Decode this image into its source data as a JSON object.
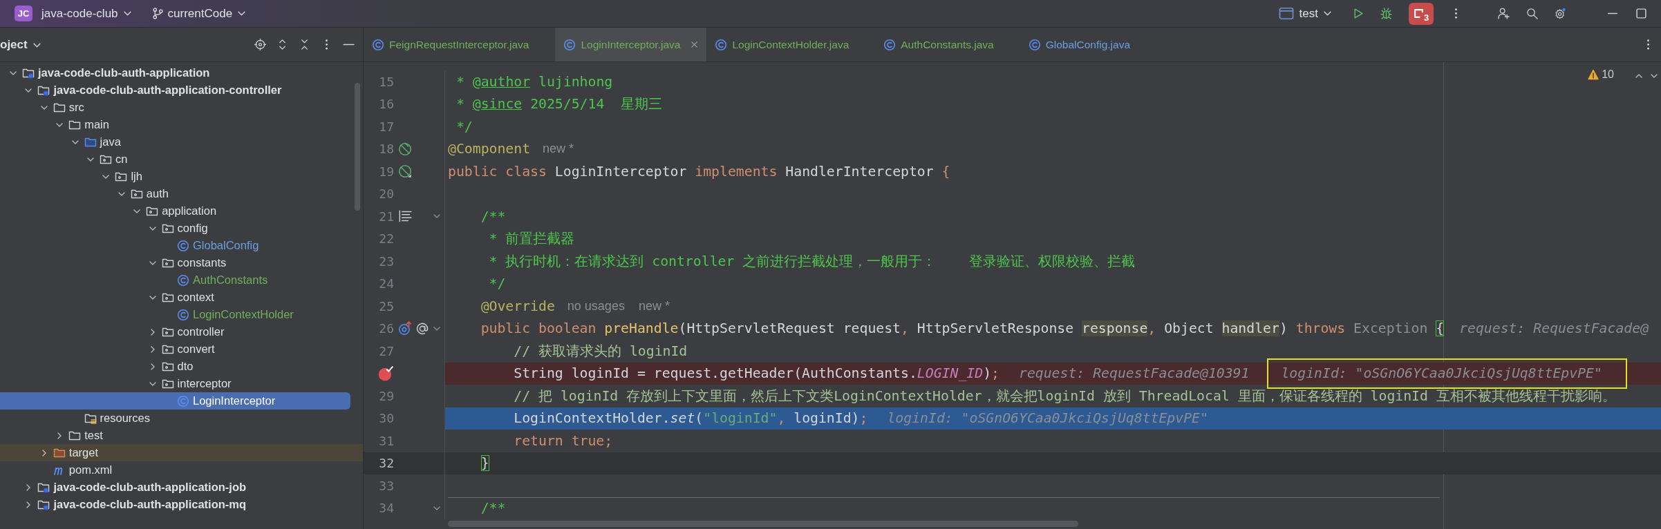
{
  "title_bar": {
    "logo": "JC",
    "project": "java-code-club",
    "branch": "currentCode",
    "run_config": "test",
    "sessions_count": "3"
  },
  "project_panel": {
    "title": "oject",
    "tree": [
      {
        "label": "java-code-club-auth-application",
        "kind": "module",
        "expanded": true,
        "selected": false,
        "children": [
          {
            "label": "java-code-club-auth-application-controller",
            "kind": "module",
            "expanded": true,
            "selected": false,
            "children": [
              {
                "label": "src",
                "kind": "folder",
                "expanded": true,
                "selected": false,
                "children": [
                  {
                    "label": "main",
                    "kind": "folder",
                    "expanded": true,
                    "selected": false,
                    "children": [
                      {
                        "label": "java",
                        "kind": "source",
                        "expanded": true,
                        "selected": false,
                        "children": [
                          {
                            "label": "cn",
                            "kind": "package",
                            "expanded": true,
                            "selected": false,
                            "children": [
                              {
                                "label": "ljh",
                                "kind": "package",
                                "expanded": true,
                                "selected": false,
                                "children": [
                                  {
                                    "label": "auth",
                                    "kind": "package",
                                    "expanded": true,
                                    "selected": false,
                                    "children": [
                                      {
                                        "label": "application",
                                        "kind": "package",
                                        "expanded": true,
                                        "selected": false,
                                        "children": [
                                          {
                                            "label": "config",
                                            "kind": "package",
                                            "expanded": true,
                                            "selected": false,
                                            "children": [
                                              {
                                                "label": "GlobalConfig",
                                                "kind": "class",
                                                "color": "#6a9fe0",
                                                "selected": false
                                              }
                                            ]
                                          },
                                          {
                                            "label": "constants",
                                            "kind": "package",
                                            "expanded": true,
                                            "selected": false,
                                            "children": [
                                              {
                                                "label": "AuthConstants",
                                                "kind": "class",
                                                "color": "#6fb05a",
                                                "selected": false
                                              }
                                            ]
                                          },
                                          {
                                            "label": "context",
                                            "kind": "package",
                                            "expanded": true,
                                            "selected": false,
                                            "children": [
                                              {
                                                "label": "LoginContextHolder",
                                                "kind": "class",
                                                "color": "#6fb05a",
                                                "selected": false
                                              }
                                            ]
                                          },
                                          {
                                            "label": "controller",
                                            "kind": "package",
                                            "expanded": false,
                                            "selected": false
                                          },
                                          {
                                            "label": "convert",
                                            "kind": "package",
                                            "expanded": false,
                                            "selected": false
                                          },
                                          {
                                            "label": "dto",
                                            "kind": "package",
                                            "expanded": false,
                                            "selected": false
                                          },
                                          {
                                            "label": "interceptor",
                                            "kind": "package",
                                            "expanded": true,
                                            "selected": false,
                                            "children": [
                                              {
                                                "label": "LoginInterceptor",
                                                "kind": "class",
                                                "selected": true
                                              }
                                            ]
                                          }
                                        ]
                                      }
                                    ]
                                  }
                                ]
                              }
                            ]
                          }
                        ]
                      },
                      {
                        "label": "resources",
                        "kind": "resources",
                        "selected": false
                      }
                    ]
                  },
                  {
                    "label": "test",
                    "kind": "folder",
                    "expanded": false,
                    "selected": false
                  }
                ]
              },
              {
                "label": "target",
                "kind": "excluded",
                "expanded": false,
                "selected": false
              },
              {
                "label": "pom.xml",
                "kind": "maven",
                "selected": false
              }
            ]
          },
          {
            "label": "java-code-club-auth-application-job",
            "kind": "module",
            "expanded": false,
            "selected": false
          },
          {
            "label": "java-code-club-auth-application-mq",
            "kind": "module",
            "expanded": false,
            "selected": false
          }
        ]
      }
    ]
  },
  "editor_tabs": [
    {
      "label": "FeignRequestInterceptor.java",
      "color": "#6fb05a",
      "selected": false
    },
    {
      "label": "LoginInterceptor.java",
      "color": "#6fb05a",
      "selected": true
    },
    {
      "label": "LoginContextHolder.java",
      "color": "#6fb05a",
      "selected": false
    },
    {
      "label": "AuthConstants.java",
      "color": "#6fb05a",
      "selected": false
    },
    {
      "label": "GlobalConfig.java",
      "color": "#6a9fe0",
      "selected": false
    }
  ],
  "editor": {
    "warnings": "10",
    "lines": [
      {
        "number": "15",
        "tokens": [
          {
            "text": " * ",
            "kind": "doc"
          },
          {
            "text": "@author",
            "kind": "doc-tag"
          },
          {
            "text": " lujinhong",
            "kind": "doc"
          }
        ]
      },
      {
        "number": "16",
        "tokens": [
          {
            "text": " * ",
            "kind": "doc"
          },
          {
            "text": "@since",
            "kind": "doc-tag"
          },
          {
            "text": " 2025/5/14  星期三",
            "kind": "doc"
          }
        ]
      },
      {
        "number": "17",
        "tokens": [
          {
            "text": " */",
            "kind": "doc"
          }
        ]
      },
      {
        "number": "18",
        "gutter": [
          {
            "kind": "bean"
          }
        ],
        "tokens": [
          {
            "text": "@Component",
            "kind": "annotation"
          },
          {
            "text": "new *",
            "kind": "hint"
          }
        ]
      },
      {
        "number": "19",
        "gutter": [
          {
            "kind": "bean-ref"
          }
        ],
        "tokens": [
          {
            "text": "public class ",
            "kind": "keyword"
          },
          {
            "text": "LoginInterceptor ",
            "kind": "plain"
          },
          {
            "text": "implements ",
            "kind": "keyword"
          },
          {
            "text": "HandlerInterceptor ",
            "kind": "plain"
          },
          {
            "text": "{",
            "kind": "keyword"
          }
        ]
      },
      {
        "number": "20"
      },
      {
        "number": "21",
        "gutter": [
          {
            "kind": "doc"
          }
        ],
        "foldable": true,
        "tokens": [
          {
            "text": "    /**",
            "kind": "doc"
          }
        ]
      },
      {
        "number": "22",
        "tokens": [
          {
            "text": "     * 前置拦截器",
            "kind": "doc"
          }
        ]
      },
      {
        "number": "23",
        "tokens": [
          {
            "text": "     * 执行时机：在请求达到 controller 之前进行拦截处理，一般用于：    登录验证、权限校验、拦截",
            "kind": "doc"
          }
        ]
      },
      {
        "number": "24",
        "tokens": [
          {
            "text": "     */",
            "kind": "doc"
          }
        ]
      },
      {
        "number": "25",
        "tokens": [
          {
            "text": "    @Override",
            "kind": "annotation"
          },
          {
            "text": "no usages",
            "kind": "hint"
          },
          {
            "text": "new *",
            "kind": "hint"
          }
        ]
      },
      {
        "number": "26",
        "gutter": [
          {
            "kind": "override"
          },
          {
            "kind": "at"
          }
        ],
        "foldable": true,
        "tokens": [
          {
            "text": "    public boolean ",
            "kind": "keyword"
          },
          {
            "text": "preHandle",
            "kind": "method"
          },
          {
            "text": "(HttpServletRequest request",
            "kind": "plain"
          },
          {
            "text": ", ",
            "kind": "keyword"
          },
          {
            "text": "HttpServletResponse ",
            "kind": "plain"
          },
          {
            "text": "response",
            "kind": "param"
          },
          {
            "text": ", ",
            "kind": "keyword"
          },
          {
            "text": "Object ",
            "kind": "plain"
          },
          {
            "text": "handler",
            "kind": "param"
          },
          {
            "text": ") ",
            "kind": "plain"
          },
          {
            "text": "throws ",
            "kind": "keyword"
          },
          {
            "text": "Exception ",
            "kind": "unused"
          },
          {
            "text": "{",
            "kind": "brace"
          },
          {
            "text": "request: RequestFacade@",
            "kind": "debug"
          }
        ]
      },
      {
        "number": "27",
        "tokens": [
          {
            "text": "        // 获取请求头的 loginId",
            "kind": "comment"
          }
        ]
      },
      {
        "breakpoint": true,
        "tokens": [
          {
            "text": "        String loginId = request.getHeader(AuthConstants.",
            "kind": "plain"
          },
          {
            "text": "LOGIN_ID",
            "kind": "constant"
          },
          {
            "text": ")",
            "kind": "plain"
          },
          {
            "text": ";",
            "kind": "keyword"
          },
          {
            "text": "request: RequestFacade@10391",
            "kind": "debug"
          },
          {
            "text": "loginId: \"oSGnO6YCaa0JkciQsjUq8ttEpvPE\"",
            "kind": "debug-boxed"
          }
        ]
      },
      {
        "number": "29",
        "tokens": [
          {
            "text": "        // 把 loginId 存放到上下文里面，然后上下文类LoginContextHolder，就会把loginId 放到 ThreadLocal 里面，保证各线程的 loginId 互相不被其他线程干扰影响。",
            "kind": "comment"
          }
        ]
      },
      {
        "number": "30",
        "execution_point": true,
        "tokens": [
          {
            "text": "        LoginContextHolder.",
            "kind": "plain"
          },
          {
            "text": "set",
            "kind": "italic"
          },
          {
            "text": "(",
            "kind": "plain"
          },
          {
            "text": "\"loginId\"",
            "kind": "string"
          },
          {
            "text": ", ",
            "kind": "keyword"
          },
          {
            "text": "loginId)",
            "kind": "plain"
          },
          {
            "text": ";",
            "kind": "keyword"
          },
          {
            "text": "loginId: \"oSGnO6YCaa0JkciQsjUq8ttEpvPE\"",
            "kind": "debug"
          }
        ]
      },
      {
        "number": "31",
        "tokens": [
          {
            "text": "        return true;",
            "kind": "keyword"
          }
        ]
      },
      {
        "number": "32",
        "current_line": true,
        "tokens": [
          {
            "text": "    }",
            "kind": "brace"
          }
        ]
      },
      {
        "number": "33"
      },
      {
        "number": "34",
        "foldable": true,
        "separator": true,
        "tokens": [
          {
            "text": "    /**",
            "kind": "doc"
          }
        ]
      }
    ]
  }
}
